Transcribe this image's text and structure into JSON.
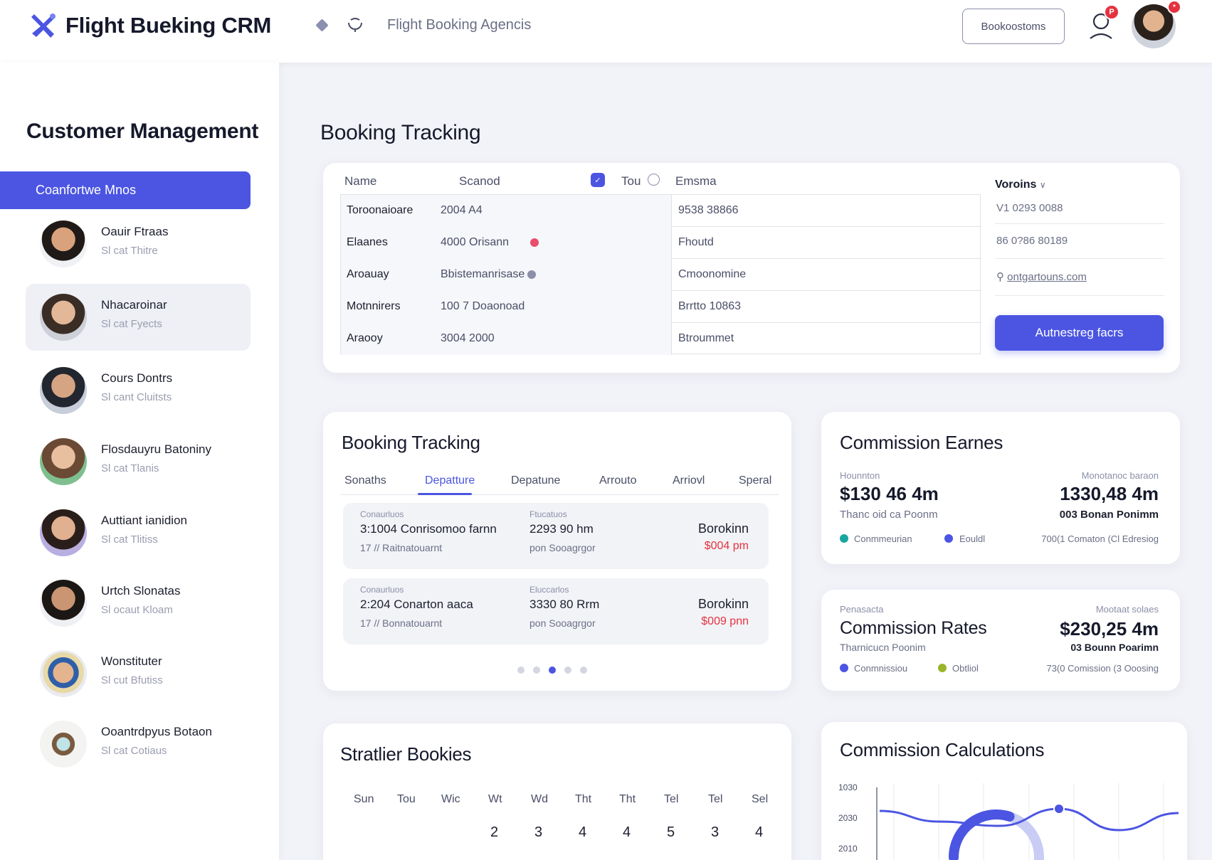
{
  "header": {
    "app_title": "Flight Bueking CRM",
    "agency_label": "Flight Booking Agencis",
    "button_label": "Bookoostoms",
    "bell_badge": "P",
    "avatar_badge": "*"
  },
  "sidebar": {
    "title": "Customer Management",
    "active_item": "Coanfortwe Mnos",
    "customers": [
      {
        "name": "Oauir Ftraas",
        "sub": "Sl cat Thitre"
      },
      {
        "name": "Nhacaroinar",
        "sub": "Sl cat Fyects"
      },
      {
        "name": "Cours Dontrs",
        "sub": "Sl cant Cluitsts"
      },
      {
        "name": "Flosdauyru Batoniny",
        "sub": "Sl cat Tlanis"
      },
      {
        "name": "Auttiant ianidion",
        "sub": "Sl cat Tlitiss"
      },
      {
        "name": "Urtch Slonatas",
        "sub": "Sl ocaut Kloam"
      },
      {
        "name": "Wonstituter",
        "sub": "Sl cut Bfutiss"
      },
      {
        "name": "Ooantrdpyus Botaon",
        "sub": "Sl cat Cotiaus"
      }
    ]
  },
  "booking_table": {
    "section_title": "Booking Tracking",
    "headers": {
      "name": "Name",
      "col2": "Scanod",
      "col3": "Tou",
      "col4": "Emsma"
    },
    "rows": [
      {
        "c1": "Toroonaioare",
        "c2": "2004 A4",
        "c3": "9538 38866"
      },
      {
        "c1": "Elaanes",
        "c2": "4000 Orisann",
        "c3": "Fhoutd"
      },
      {
        "c1": "Aroauay",
        "c2": "Bbistemanrisase",
        "c3": "Cmoonomine"
      },
      {
        "c1": "Motnnirers",
        "c2": "100 7 Doaonoad",
        "c3": "Brrtto 10863"
      },
      {
        "c1": "Araooy",
        "c2": "3004 2000",
        "c3": "Btroummet"
      }
    ],
    "row_dot_colors": [
      "#e94e6b",
      "#8b8fa8"
    ],
    "details": {
      "title": "Voroins",
      "line1": "V1 0293 0088",
      "line2": "86  0?86 80189",
      "line3": "ontgartouns.com",
      "button": "Autnestreg facrs"
    }
  },
  "booking_tracking": {
    "title": "Booking Tracking",
    "tabs": [
      "Sonaths",
      "Depatture",
      "Depatune",
      "Arrouto",
      "Arriovl",
      "Speral"
    ],
    "active_tab": 1,
    "bookings": [
      {
        "tiny1": "Conaurluos",
        "main1": "3:1004  Conrisomoo farnn",
        "small1": "17  // Raitnatouarnt",
        "tiny2": "Ftucatuos",
        "main2": "2293 90  hm",
        "small2": "pon Sooagrgor",
        "right": "Borokinn",
        "price": "$004 pm"
      },
      {
        "tiny1": "Conaurluos",
        "main1": "2:204  Conarton aaca",
        "small1": "17  // Bonnatouarnt",
        "tiny2": "Eluccarlos",
        "main2": "3330 80  Rrm",
        "small2": "pon Sooagrgor",
        "right": "Borokinn",
        "price": "$009 pnn"
      }
    ],
    "pages": 5,
    "active_page": 2
  },
  "commission_earned": {
    "title": "Commission Earnes",
    "left_label": "Hounnton",
    "left_value": "$130 46 4m",
    "left_sub": "Thanc oid ca Poonm",
    "right_label": "Monotanoc baraon",
    "right_value": "1330,48 4m",
    "right_sub": "003 Bonan Ponimm",
    "legend": [
      {
        "label": "Conmmeurian",
        "color": "#1aa6a0"
      },
      {
        "label": "Eouldl",
        "color": "#4b55e2"
      }
    ],
    "footer": "700(1 Comaton (Cl Edresiog"
  },
  "commission_rates": {
    "small_left": "Penasacta",
    "title": "Commission Rates",
    "sub_left": "Tharnicucn Poonim",
    "small_right": "Mootaat solaes",
    "right_value": "$230,25 4m",
    "right_sub": "03 Bounn Poarimn",
    "legend": [
      {
        "label": "Conmnissiou",
        "color": "#4b55e2"
      },
      {
        "label": "Obtliol",
        "color": "#9ab52a"
      }
    ],
    "footer": "73(0 Comission (3 Ooosing"
  },
  "calendar": {
    "title": "Stratlier Bookies",
    "days": [
      "Sun",
      "Tou",
      "Wic",
      "Wt",
      "Wd",
      "Tht",
      "Tht",
      "Tel",
      "Tel",
      "Sel"
    ],
    "numbers": [
      "2",
      "3",
      "4",
      "4",
      "5",
      "3",
      "4"
    ]
  },
  "chart_data": {
    "type": "line",
    "title": "Commission Calculations",
    "ytick_labels": [
      "1030",
      "2030",
      "2010"
    ],
    "series": [
      {
        "values": [
          2025,
          2020,
          2018,
          2026,
          2016,
          2024
        ]
      }
    ],
    "gauge_fraction": 0.6,
    "grid": true,
    "colors": {
      "line": "#4b55e2",
      "gauge_light": "#c9ccf5"
    }
  }
}
